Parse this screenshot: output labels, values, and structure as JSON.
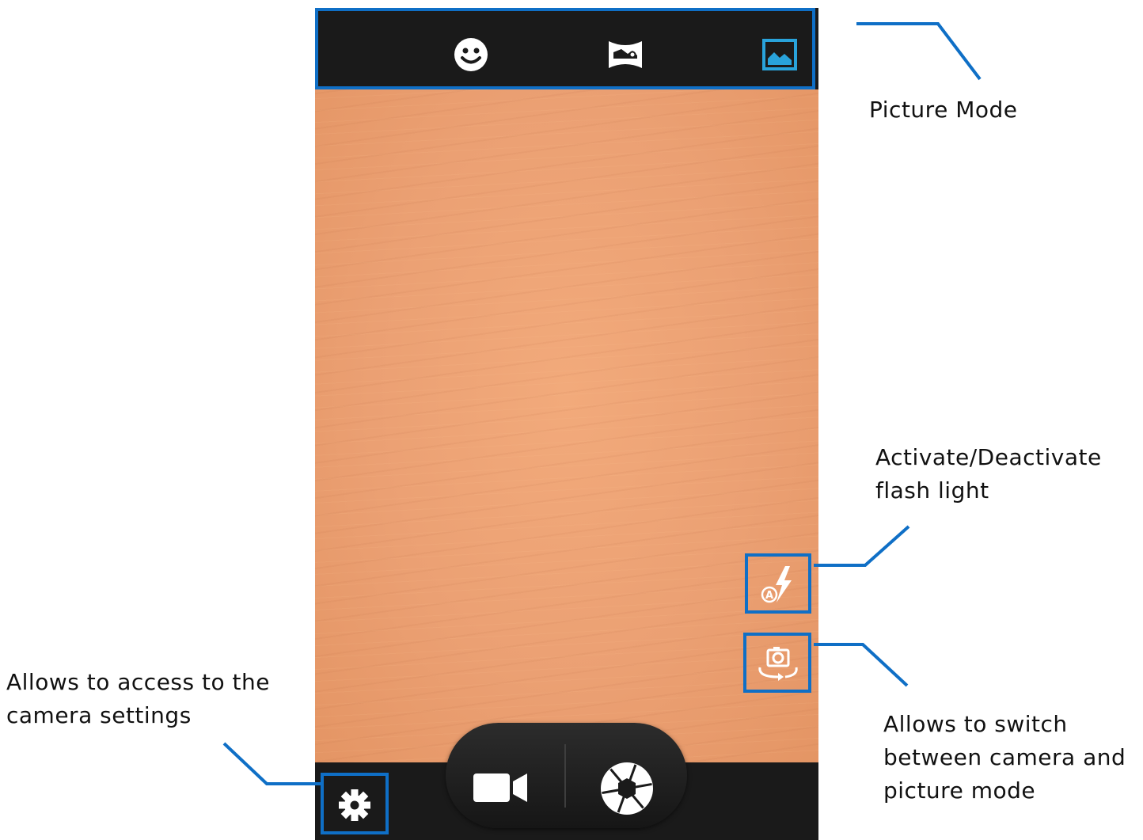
{
  "colors": {
    "accent_blue": "#0f6fc6",
    "mode_active": "#29a3db",
    "bar_background": "#1a1a1a",
    "viewfinder": "#eba073",
    "icon_white": "#ffffff"
  },
  "mode_bar": {
    "modes": [
      {
        "icon": "face-detection-icon",
        "active": false
      },
      {
        "icon": "panorama-icon",
        "active": false
      },
      {
        "icon": "picture-mode-icon",
        "active": true
      }
    ]
  },
  "side_controls": {
    "flash": {
      "icon": "flash-auto-icon",
      "badge": "A"
    },
    "switch_camera": {
      "icon": "switch-camera-icon"
    }
  },
  "bottom_controls": {
    "settings": {
      "icon": "gear-icon"
    },
    "video": {
      "icon": "video-camera-icon"
    },
    "shutter": {
      "icon": "shutter-icon"
    }
  },
  "annotations": {
    "picture_mode": "Picture Mode",
    "flash_line1": "Activate/Deactivate",
    "flash_line2": "flash light",
    "switch_line1": "Allows to switch",
    "switch_line2": "between camera and",
    "switch_line3": "picture mode",
    "settings_line1": "Allows to access to the",
    "settings_line2": "camera settings"
  }
}
